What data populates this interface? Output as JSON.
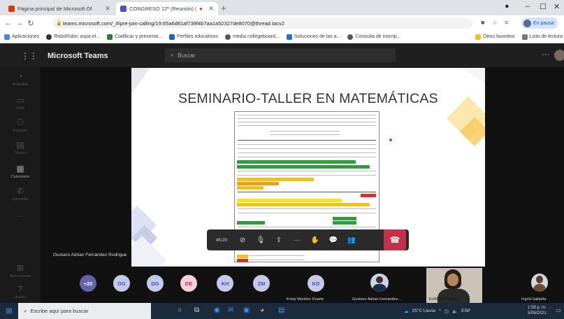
{
  "browser": {
    "tabs": [
      {
        "title": "Página principal de Microsoft Of",
        "favicon_color": "#d83b01"
      },
      {
        "title": "CONGRESO 12º (Reunión) |",
        "favicon_color": "#4b53bc"
      }
    ],
    "new_tab": "+",
    "controls": {
      "minimize": "–",
      "maximize": "☐",
      "close": "✕"
    },
    "url": "teams.microsoft.com/_#/pre-join-calling/19:65a6d81af739f4b7aa1a52327de8070@thread.tacv2",
    "profile_label": "En pausa",
    "bookmarks": [
      {
        "label": "Aplicaciones",
        "color": "#4285f4"
      },
      {
        "label": "RoboRobo: aspa el...",
        "color": "#333"
      },
      {
        "label": "Codificar y presenta...",
        "color": "#2e7d32"
      },
      {
        "label": "Perfiles educativos",
        "color": "#1565c0"
      },
      {
        "label": "media.collegeboard...",
        "color": "#555"
      },
      {
        "label": "Soluciones de las a...",
        "color": "#1976d2"
      },
      {
        "label": "Consulta de inscrip...",
        "color": "#555"
      }
    ],
    "bookmarks_right": [
      "Otros favoritos",
      "Lista de lectura"
    ]
  },
  "teams": {
    "app_name": "Microsoft Teams",
    "search_placeholder": "Buscar",
    "rail": [
      "Actividad",
      "Chat",
      "Equipos",
      "Tareas",
      "Calendario",
      "Llamadas",
      "...",
      "Aplicaciones",
      "Ayuda"
    ],
    "rail_active": "Calendario"
  },
  "meeting": {
    "slide_title": "SEMINARIO-TALLER EN MATEMÁTICAS",
    "speaker_name": "Gustavo Adrian Fernández Rodrigue",
    "timer": "45:20",
    "participants": [
      {
        "initials": "+20",
        "bg": "#6264a7",
        "fg": "#fff"
      },
      {
        "initials": "OG",
        "bg": "#c5cae9",
        "fg": "#3f51b5"
      },
      {
        "initials": "DG",
        "bg": "#c5cae9",
        "fg": "#3f51b5"
      },
      {
        "initials": "DE",
        "bg": "#f8d0d8",
        "fg": "#b0304f"
      },
      {
        "initials": "KH",
        "bg": "#c5cae9",
        "fg": "#3f51b5"
      },
      {
        "initials": "ZM",
        "bg": "#c5cae9",
        "fg": "#3f51b5"
      },
      {
        "initials": "KD",
        "bg": "#c5cae9",
        "fg": "#3f51b5",
        "name": "Kristy Montser Duarte"
      }
    ],
    "video_tiles": [
      {
        "name": "Gustavo Adrian Fernández..."
      },
      {
        "name": "EVELIN TOCHEZ"
      },
      {
        "name": "Ingrid Saldaña"
      }
    ]
  },
  "taskbar": {
    "search_placeholder": "Escribe aquí para buscar",
    "weather": "25°C Lluvia",
    "lang": "ESP",
    "time": "1:58 p. m.",
    "date": "5/06/2021"
  }
}
